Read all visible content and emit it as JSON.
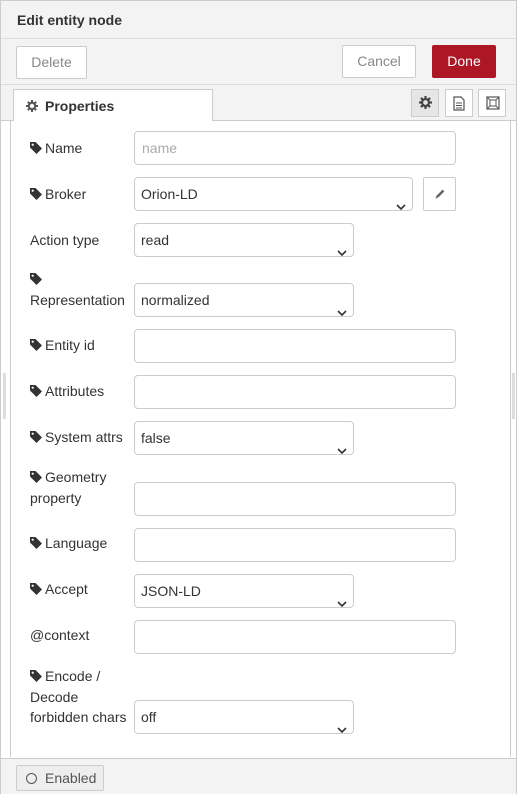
{
  "header": {
    "title": "Edit entity node"
  },
  "toolbar": {
    "delete_label": "Delete",
    "cancel_label": "Cancel",
    "done_label": "Done"
  },
  "tabs": {
    "properties_label": "Properties"
  },
  "form": {
    "name": {
      "label": "Name",
      "placeholder": "name",
      "value": ""
    },
    "broker": {
      "label": "Broker",
      "value": "Orion-LD"
    },
    "action_type": {
      "label": "Action type",
      "value": "read"
    },
    "representation": {
      "label": "Representation",
      "value": "normalized"
    },
    "entity_id": {
      "label": "Entity id",
      "value": ""
    },
    "attributes": {
      "label": "Attributes",
      "value": ""
    },
    "system_attrs": {
      "label": "System attrs",
      "value": "false"
    },
    "geometry_property": {
      "label_line1": "Geometry",
      "label_line2": "property",
      "value": ""
    },
    "language": {
      "label": "Language",
      "value": ""
    },
    "accept": {
      "label": "Accept",
      "value": "JSON-LD"
    },
    "context": {
      "label": "@context",
      "value": ""
    },
    "encode_decode": {
      "label_line1": "Encode /",
      "label_line2": "Decode",
      "label_line3": "forbidden chars",
      "value": "off"
    }
  },
  "footer": {
    "enabled_label": "Enabled"
  },
  "colors": {
    "done_button": "#ad1625",
    "panel_bg": "#f3f3f3",
    "border": "#cccccc"
  },
  "icons": [
    "cog-icon",
    "tag-icon",
    "pencil-icon",
    "file-icon",
    "expand-icon",
    "chevron-down-icon",
    "circle-icon"
  ]
}
